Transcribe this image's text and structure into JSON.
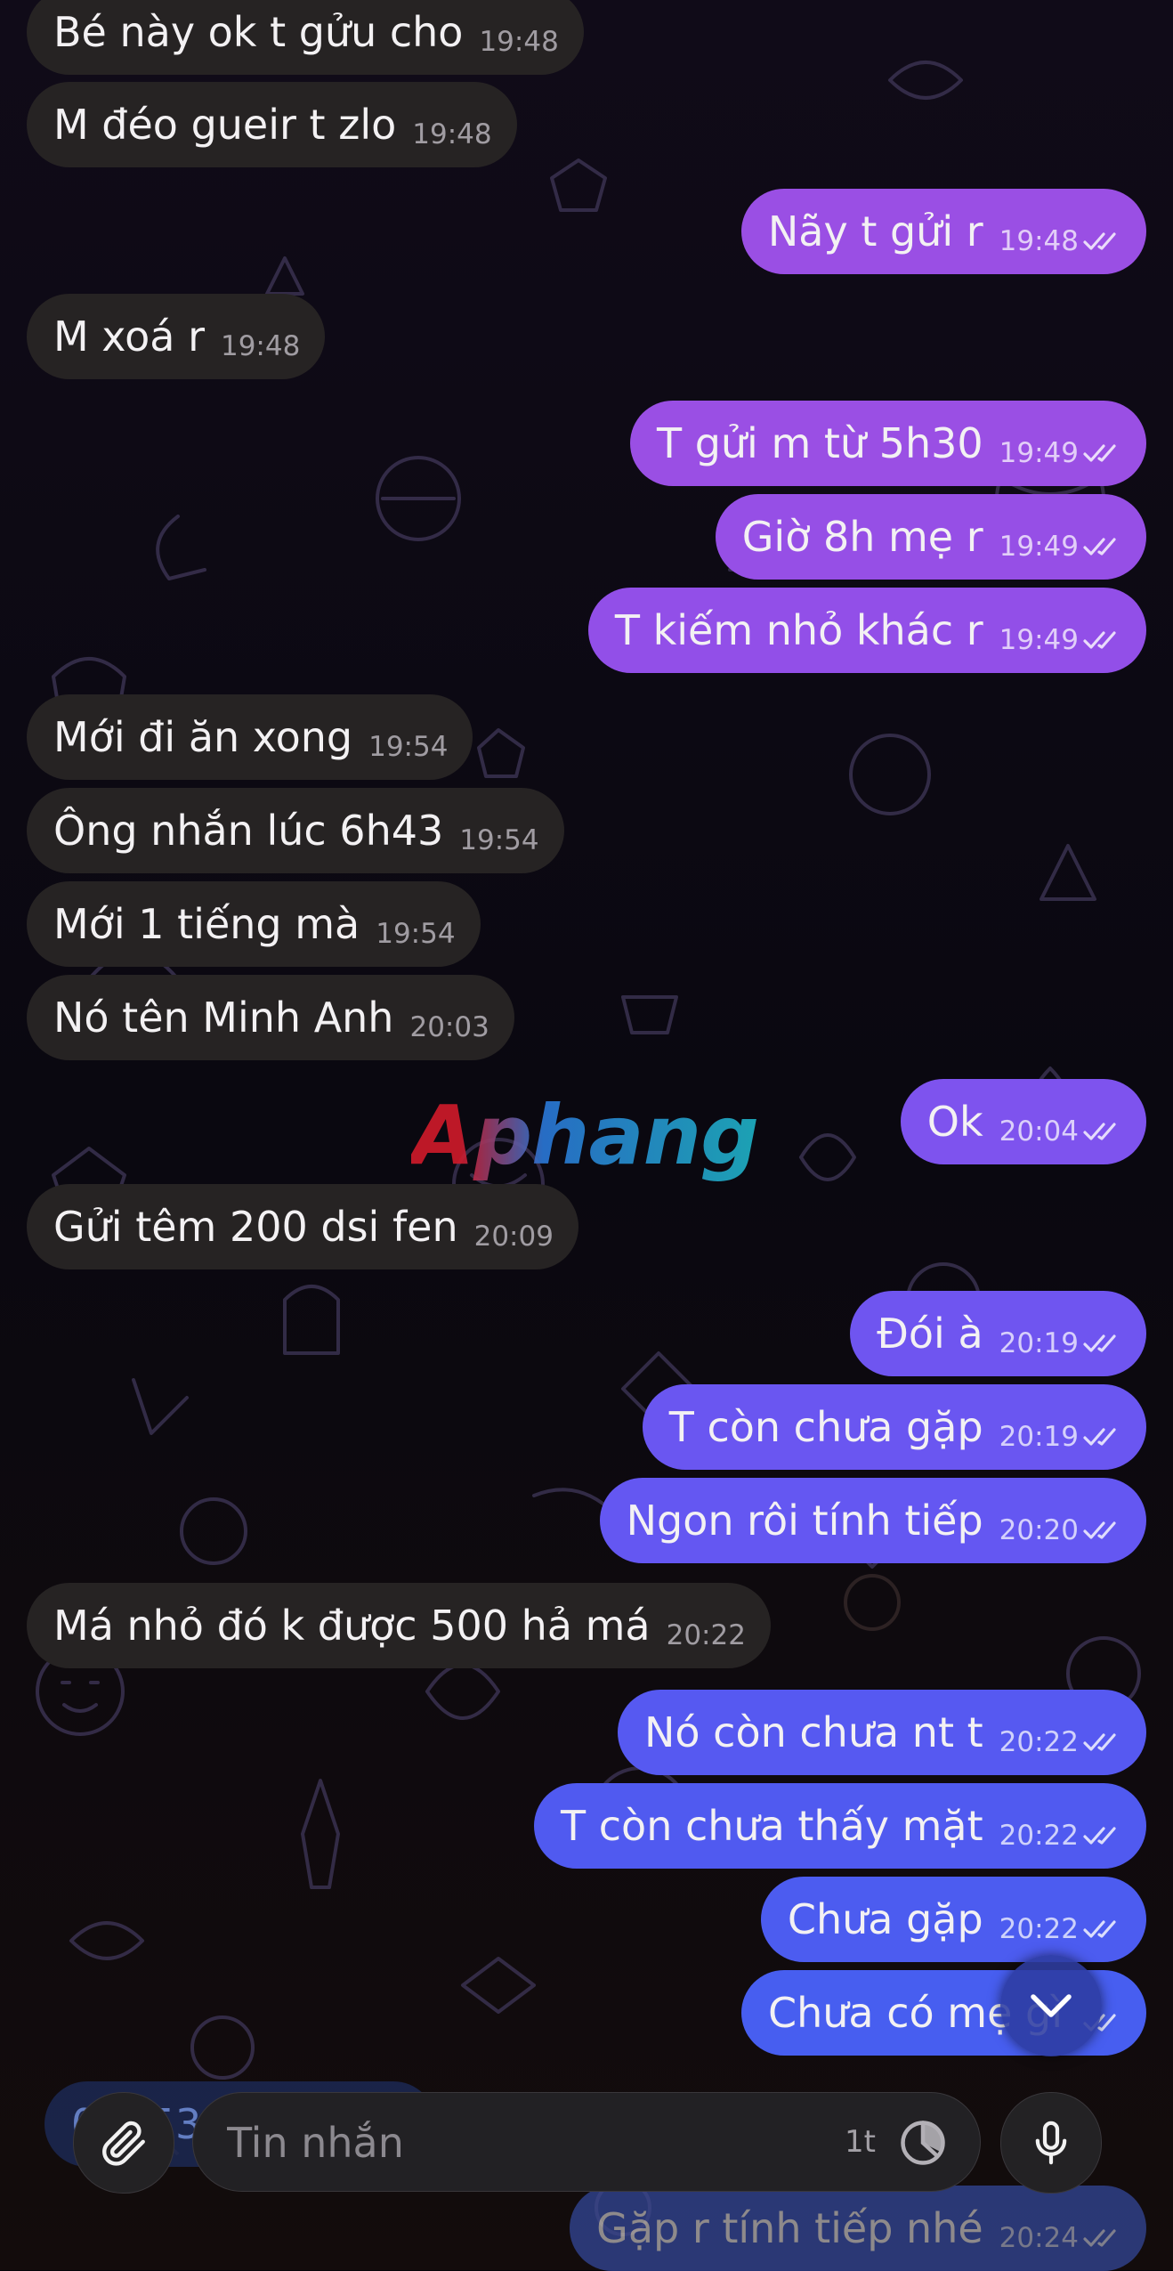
{
  "chat": {
    "messages": [
      {
        "side": "in",
        "text": "Bé này ok t gửu cho",
        "time": "19:48"
      },
      {
        "side": "in",
        "text": "M đéo gueir t zlo",
        "time": "19:48"
      },
      {
        "side": "out",
        "text": "Nãy t gửi r",
        "time": "19:48",
        "color": "#9a4fe4"
      },
      {
        "side": "in",
        "text": "M xoá r",
        "time": "19:48"
      },
      {
        "side": "out",
        "text": "T gửi m từ 5h30",
        "time": "19:49",
        "color": "#9a4fe4"
      },
      {
        "side": "out",
        "text": "Giờ 8h mẹ r",
        "time": "19:49",
        "color": "#964fe6"
      },
      {
        "side": "out",
        "text": "T kiếm nhỏ khác r",
        "time": "19:49",
        "color": "#924fe8"
      },
      {
        "side": "in",
        "text": "Mới đi ăn xong",
        "time": "19:54"
      },
      {
        "side": "in",
        "text": "Ông nhắn lúc 6h43",
        "time": "19:54"
      },
      {
        "side": "in",
        "text": "Mới 1 tiếng mà",
        "time": "19:54"
      },
      {
        "side": "in",
        "text": "Nó tên Minh Anh",
        "time": "20:03"
      },
      {
        "side": "out",
        "text": "Ok",
        "time": "20:04",
        "color": "#7e53ee"
      },
      {
        "side": "in",
        "text": "Gửi têm 200 dsi fen",
        "time": "20:09"
      },
      {
        "side": "out",
        "text": "Đói à",
        "time": "20:19",
        "color": "#6f55f0"
      },
      {
        "side": "out",
        "text": "T còn chưa gặp",
        "time": "20:19",
        "color": "#6a56f1"
      },
      {
        "side": "out",
        "text": "Ngon rôi tính tiếp",
        "time": "20:20",
        "color": "#6457f2"
      },
      {
        "side": "in",
        "text": "Má nhỏ đó k được 500 hả má",
        "time": "20:22"
      },
      {
        "side": "out",
        "text": "Nó còn chưa nt t",
        "time": "20:22",
        "color": "#5659f1"
      },
      {
        "side": "out",
        "text": "T còn chưa thấy mặt",
        "time": "20:22",
        "color": "#505af0"
      },
      {
        "side": "out",
        "text": "Chưa gặp",
        "time": "20:22",
        "color": "#4c5cf0"
      },
      {
        "side": "out",
        "text": "Chưa có mẹ gì",
        "time": "",
        "color": "#475ef0"
      }
    ],
    "partial_bottom": {
      "text": "Gặp r tính tiếp nhé",
      "time": "20:24",
      "color": "#3f5ccc"
    },
    "partial_left": {
      "text": "0... 53..."
    }
  },
  "watermark": "Aphang",
  "composer": {
    "placeholder": "Tin nhắn",
    "timer_label": "1t"
  },
  "icons": {
    "attach": "paperclip-icon",
    "mic": "microphone-icon",
    "timer": "timer-icon",
    "scroll": "chevron-down-icon",
    "read": "double-check-icon"
  }
}
